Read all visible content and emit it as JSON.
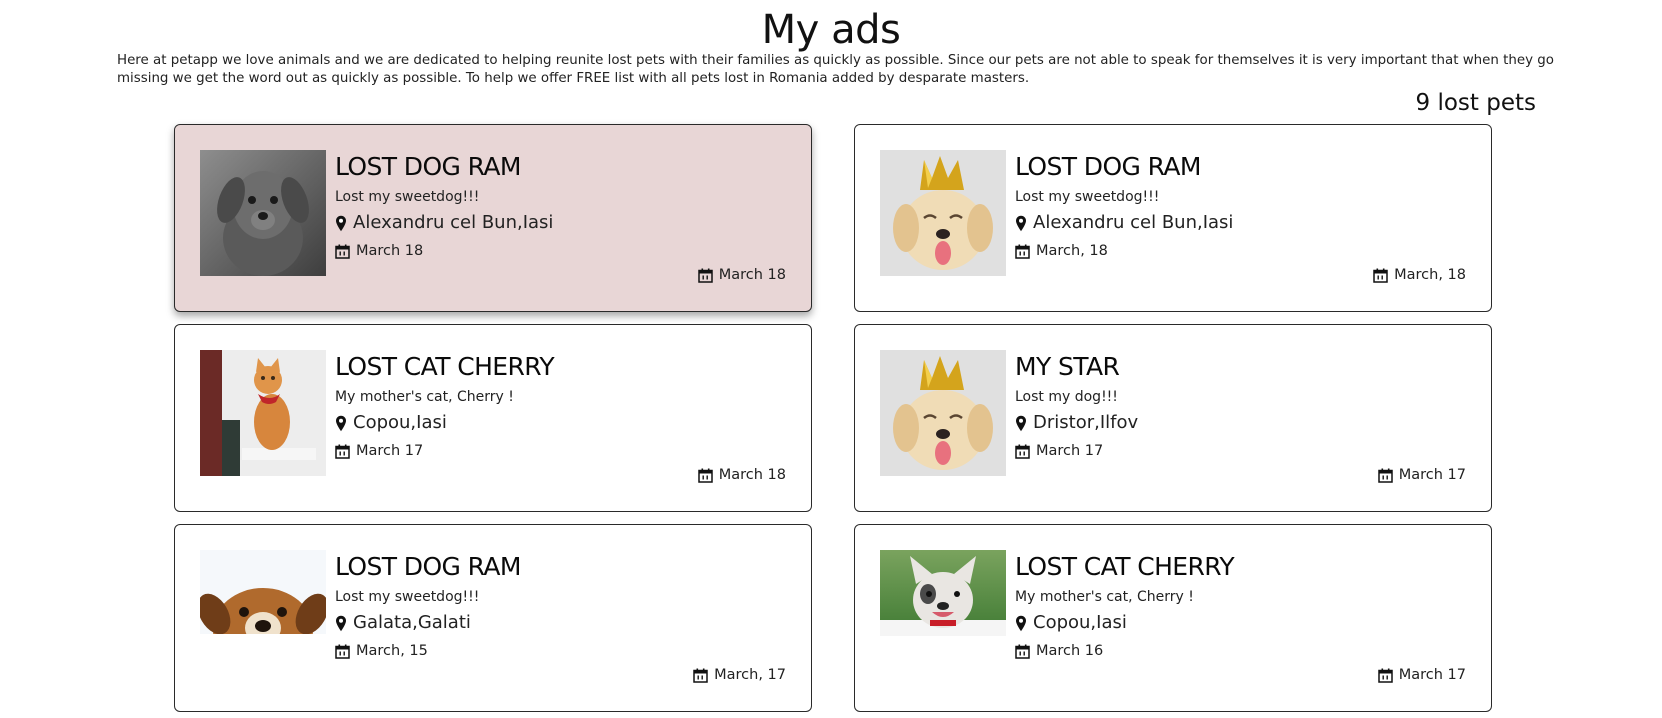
{
  "page": {
    "title": "My ads",
    "intro": "Here at petapp we love animals and we are dedicated to helping reunite lost pets with their families as quickly as possible. Since our pets are not able to speak for themselves it is very important that when they go missing we get the word out as quickly as possible. To help we offer FREE list with all pets lost in Romania added by desparate masters.",
    "count_label": "9 lost pets"
  },
  "ads": [
    {
      "title": "LOST DOG RAM",
      "description": "Lost my sweetdog!!!",
      "location": "Alexandru cel Bun,Iasi",
      "lost_date": "March 18",
      "posted_date": "March 18",
      "image": "grey-puppy-photo",
      "highlighted": true
    },
    {
      "title": "LOST DOG RAM",
      "description": "Lost my sweetdog!!!",
      "location": "Alexandru cel Bun,Iasi",
      "lost_date": "March, 18",
      "posted_date": "March, 18",
      "image": "golden-puppy-crown-photo",
      "highlighted": false
    },
    {
      "title": "LOST CAT CHERRY",
      "description": "My mother's cat, Cherry !",
      "location": "Copou,Iasi",
      "lost_date": "March 17",
      "posted_date": "March 18",
      "image": "orange-cat-photo",
      "highlighted": false
    },
    {
      "title": "MY STAR",
      "description": "Lost my dog!!!",
      "location": "Dristor,Ilfov",
      "lost_date": "March 17",
      "posted_date": "March 17",
      "image": "golden-puppy-crown-photo",
      "highlighted": false
    },
    {
      "title": "LOST DOG RAM",
      "description": "Lost my sweetdog!!!",
      "location": "Galata,Galati",
      "lost_date": "March, 15",
      "posted_date": "March, 17",
      "image": "brown-dog-peeking-photo",
      "highlighted": false
    },
    {
      "title": "LOST CAT CHERRY",
      "description": "My mother's cat, Cherry !",
      "location": "Copou,Iasi",
      "lost_date": "March 16",
      "posted_date": "March 17",
      "image": "french-bulldog-photo",
      "highlighted": false
    }
  ],
  "icons": {
    "location": "map-pin-icon",
    "calendar": "calendar-icon"
  },
  "colors": {
    "highlight_background": "#e8d6d6",
    "card_border": "#2a2a2a",
    "text": "#111111"
  }
}
